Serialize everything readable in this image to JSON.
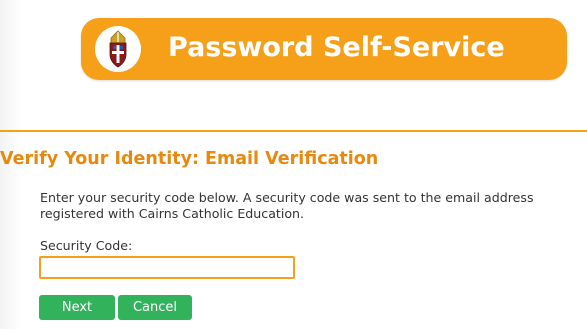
{
  "header": {
    "title": "Password Self-Service",
    "logo_icon": "cathedral-crest-icon",
    "accent_color": "#f5a018"
  },
  "section": {
    "title": "Verify Your Identity:  Email Verification",
    "title_color": "#e8890f"
  },
  "instructions": "Enter your security code below. A security code was sent to the email address registered with Cairns Catholic Education.",
  "form": {
    "label": "Security Code:",
    "input_value": "",
    "input_placeholder": ""
  },
  "buttons": {
    "next_label": "Next",
    "cancel_label": "Cancel",
    "button_color": "#33b25c"
  }
}
